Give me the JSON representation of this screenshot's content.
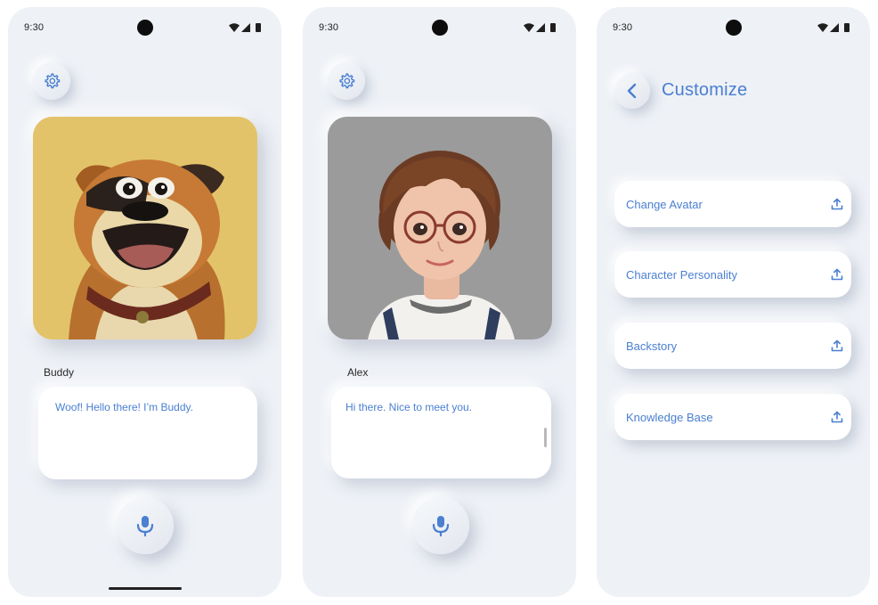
{
  "colors": {
    "accent": "#4a7fd1",
    "screen_bg": "#eef1f6",
    "buddy_bg": "#e3c36a",
    "alex_bg": "#9b9b9b"
  },
  "screens": [
    {
      "status_time": "9:30",
      "settings_icon": "gear-icon",
      "character_name": "Buddy",
      "speech_text": "Woof! Hello there! I’m Buddy.",
      "mic_icon": "microphone-icon"
    },
    {
      "status_time": "9:30",
      "settings_icon": "gear-icon",
      "character_name": "Alex",
      "speech_text": "Hi there. Nice to meet you.",
      "mic_icon": "microphone-icon"
    },
    {
      "status_time": "9:30",
      "back_icon": "chevron-left-icon",
      "title": "Customize",
      "items": [
        {
          "label": "Change Avatar",
          "icon": "upload-icon"
        },
        {
          "label": "Character Personality",
          "icon": "upload-icon"
        },
        {
          "label": "Backstory",
          "icon": "upload-icon"
        },
        {
          "label": "Knowledge Base",
          "icon": "upload-icon"
        }
      ]
    }
  ]
}
